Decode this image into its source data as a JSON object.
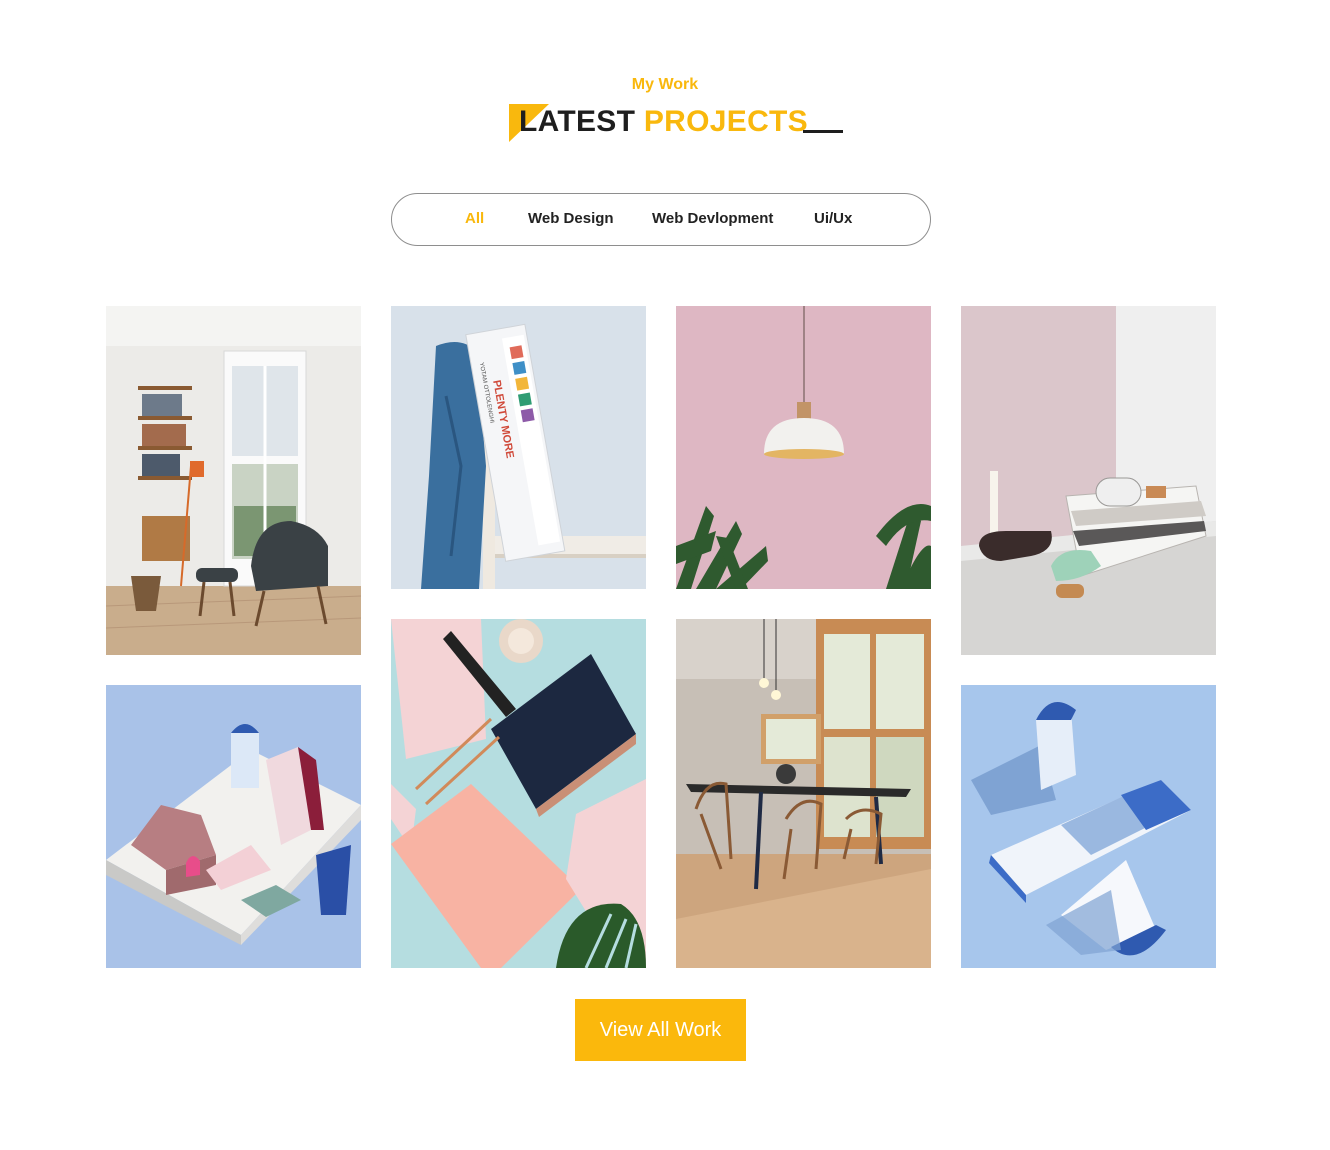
{
  "section": {
    "eyebrow": "My Work",
    "title_part1": "LATEST",
    "title_part2": "PROJECTS"
  },
  "filters": [
    {
      "label": "All",
      "active": true
    },
    {
      "label": "Web Design",
      "active": false
    },
    {
      "label": "Web Devlopment",
      "active": false
    },
    {
      "label": "Ui/Ux",
      "active": false
    }
  ],
  "gallery": {
    "book_spine_text": "PLENTY MORE",
    "book_author_text": "YOTAM OTTOLENGHI"
  },
  "cta": {
    "label": "View All Work"
  },
  "colors": {
    "accent": "#f9b80d",
    "heading": "#1e1e1e",
    "button": "#fbb80c"
  }
}
